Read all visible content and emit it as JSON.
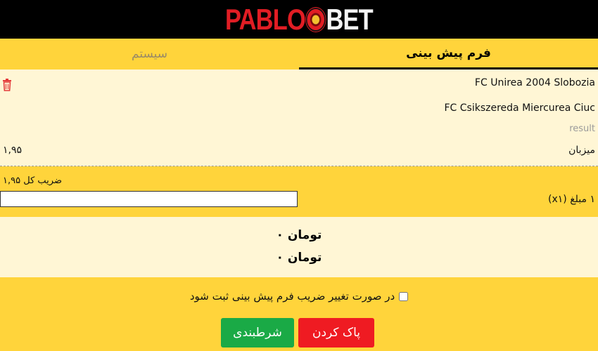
{
  "header": {
    "logo_left": "PABLO",
    "logo_right": "BET"
  },
  "tabs": [
    {
      "label": "فرم پیش بینی",
      "active": true
    },
    {
      "label": "سیستم",
      "active": false
    }
  ],
  "bet": {
    "home_team": "FC Unirea 2004 Slobozia",
    "away_team": "FC Csikszereda Miercurea Ciuc",
    "result_label": "result",
    "selection": "میزبان",
    "odds": "۱,۹۵"
  },
  "totals": {
    "total_odds": "ضریب کل ۱,۹۵",
    "stake_label": "۱ مبلغ (x۱)",
    "stake_value": ""
  },
  "summary": {
    "line1": "تومان ۰",
    "line2": "تومان ۰"
  },
  "footer": {
    "accept_odds_change": "در صورت تغییر ضریب فرم پیش بینی ثبت شود",
    "clear_label": "پاک کردن",
    "place_label": "شرطبندی"
  },
  "colors": {
    "accent": "#ffd43b",
    "panel": "#fff6d5",
    "danger": "#ef1b22",
    "success": "#1aaa46"
  }
}
